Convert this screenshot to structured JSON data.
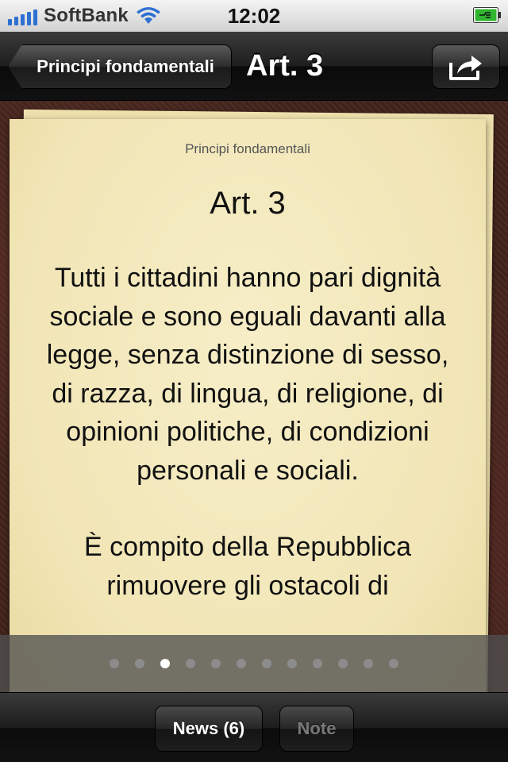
{
  "status_bar": {
    "carrier": "SoftBank",
    "time": "12:02",
    "signal_icon": "signal-bars-icon",
    "wifi_icon": "wifi-icon",
    "battery_icon": "battery-charging-icon"
  },
  "nav": {
    "back_label": "Principi fondamentali",
    "title": "Art. 3",
    "share_icon": "share-icon"
  },
  "article": {
    "section": "Principi fondamentali",
    "title": "Art. 3",
    "paragraphs": [
      "Tutti i cittadini hanno pari dignità sociale e sono eguali davanti alla legge, senza distinzione di sesso, di razza, di lingua, di religione, di opinioni politiche, di condizioni personali e sociali.",
      "È compito della Repubblica rimuovere gli ostacoli di"
    ]
  },
  "page_control": {
    "total_pages": 12,
    "current_page": 3
  },
  "toolbar": {
    "news_label": "News (6)",
    "note_label": "Note"
  },
  "colors": {
    "paper": "#f3e8bc",
    "leather": "#3f241d",
    "status_signal": "#2e6fd2",
    "battery_green": "#2fb52f"
  }
}
